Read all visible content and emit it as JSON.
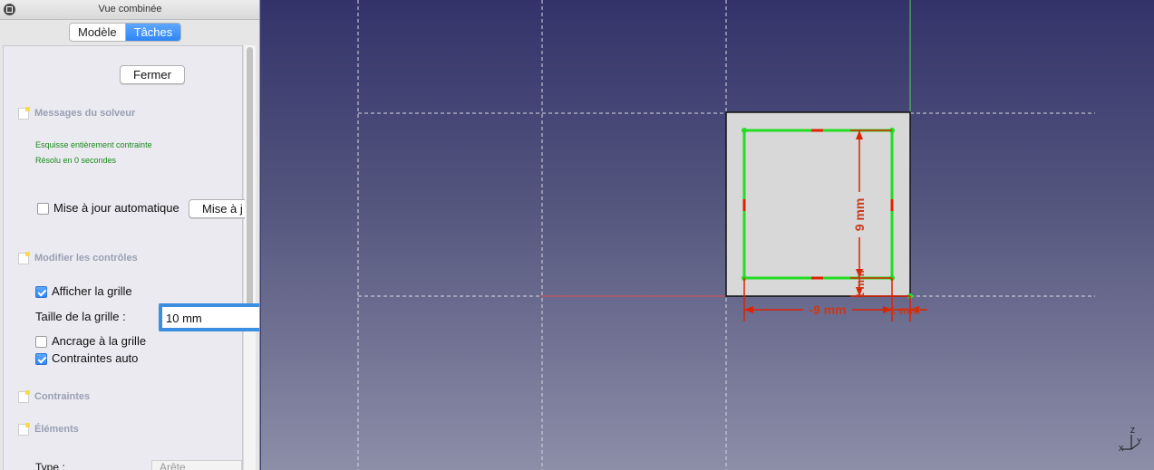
{
  "panel": {
    "title": "Vue combinée",
    "tabs": [
      {
        "label": "Modèle",
        "active": false
      },
      {
        "label": "Tâches",
        "active": true
      }
    ],
    "close_button": "Fermer",
    "solver_section": {
      "title": "Messages du solveur",
      "messages": [
        "Esquisse entièrement contrainte",
        "Résolu en 0 secondes"
      ]
    },
    "auto_update": {
      "label": "Mise à jour automatique",
      "checked": false,
      "button": "Mise à j"
    },
    "controls_section": {
      "title": "Modifier les contrôles",
      "show_grid": {
        "label": "Afficher la grille",
        "checked": true
      },
      "grid_size": {
        "label": "Taille de la grille :",
        "value": "10 mm"
      },
      "snap_grid": {
        "label": "Ancrage à la grille",
        "checked": false
      },
      "auto_constraints": {
        "label": "Contraintes auto",
        "checked": true
      }
    },
    "constraints_section": {
      "title": "Contraintes"
    },
    "elements_section": {
      "title": "Éléments",
      "type_label": "Type :",
      "type_value": "Arête"
    }
  },
  "viewport": {
    "dimensions": {
      "vertical": "9 mm",
      "vertical_small": "1 mm",
      "horizontal": "-9 mm",
      "horizontal_small": "-1 mm"
    },
    "axis_labels": {
      "x": "X",
      "y": "Y",
      "z": "Z"
    },
    "colors": {
      "background_top": "#33336a",
      "background_bottom": "#8d8ea8",
      "sketch_lines": "#22dd22",
      "constraints": "#dd2200",
      "face": "#d8d8d8",
      "y_axis": "#4fd64f",
      "x_axis": "#e05050"
    }
  }
}
